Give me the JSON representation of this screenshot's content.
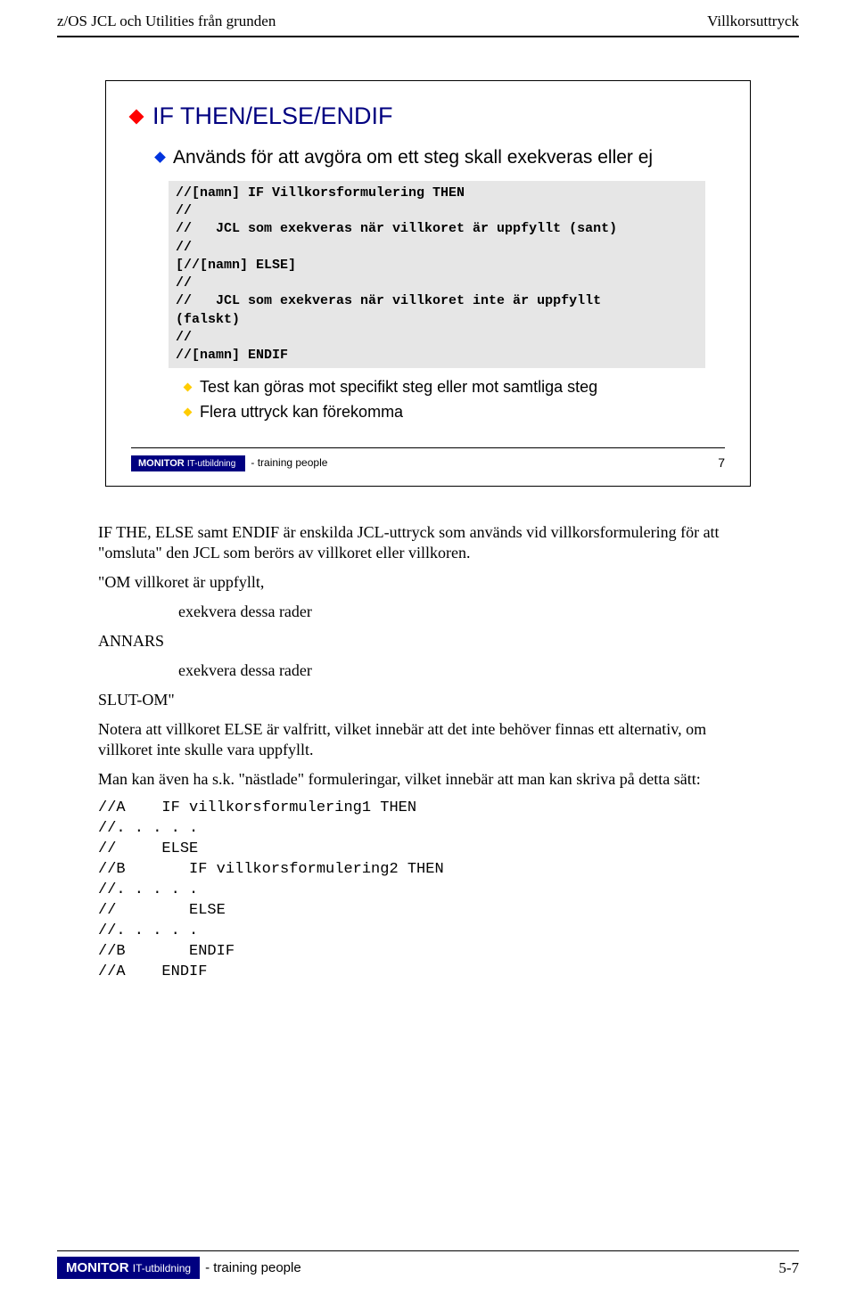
{
  "header": {
    "left": "z/OS JCL och Utilities från grunden",
    "right": "Villkorsuttryck"
  },
  "slide": {
    "title": "IF THEN/ELSE/ENDIF",
    "sub": "Används för att avgöra om ett steg skall exekveras eller ej",
    "code": "//[namn] IF Villkorsformulering THEN\n//\n//   JCL som exekveras när villkoret är uppfyllt (sant)\n//\n[//[namn] ELSE]\n//\n//   JCL som exekveras när villkoret inte är uppfyllt\n(falskt)\n//\n//[namn] ENDIF",
    "point1": "Test kan göras mot specifikt steg eller mot samtliga steg",
    "point2": "Flera uttryck kan förekomma",
    "footerBrand": "MONITOR",
    "footerBrandSub": "IT-utbildning",
    "footerTag": "- training people",
    "pageNum": "7"
  },
  "body": {
    "p1": "IF THE, ELSE samt ENDIF är enskilda JCL-uttryck som används vid villkorsformulering för att \"omsluta\" den JCL som berörs av villkoret eller villkoren.",
    "p2": "\"OM villkoret är uppfyllt,",
    "p3": "exekvera dessa rader",
    "p4": "ANNARS",
    "p5": "exekvera dessa rader",
    "p6": "SLUT-OM\"",
    "p7": "Notera att villkoret ELSE är valfritt, vilket innebär att det inte behöver finnas ett alternativ, om villkoret inte skulle vara uppfyllt.",
    "p8": "Man kan även ha s.k. \"nästlade\" formuleringar, vilket innebär att man kan skriva på detta sätt:",
    "code": "//A    IF villkorsformulering1 THEN\n//. . . . .\n//     ELSE\n//B       IF villkorsformulering2 THEN\n//. . . . .\n//        ELSE\n//. . . . .\n//B       ENDIF\n//A    ENDIF"
  },
  "footer": {
    "brand": "MONITOR",
    "brandSub": "IT-utbildning",
    "tag": "- training people",
    "page": "5-7"
  }
}
